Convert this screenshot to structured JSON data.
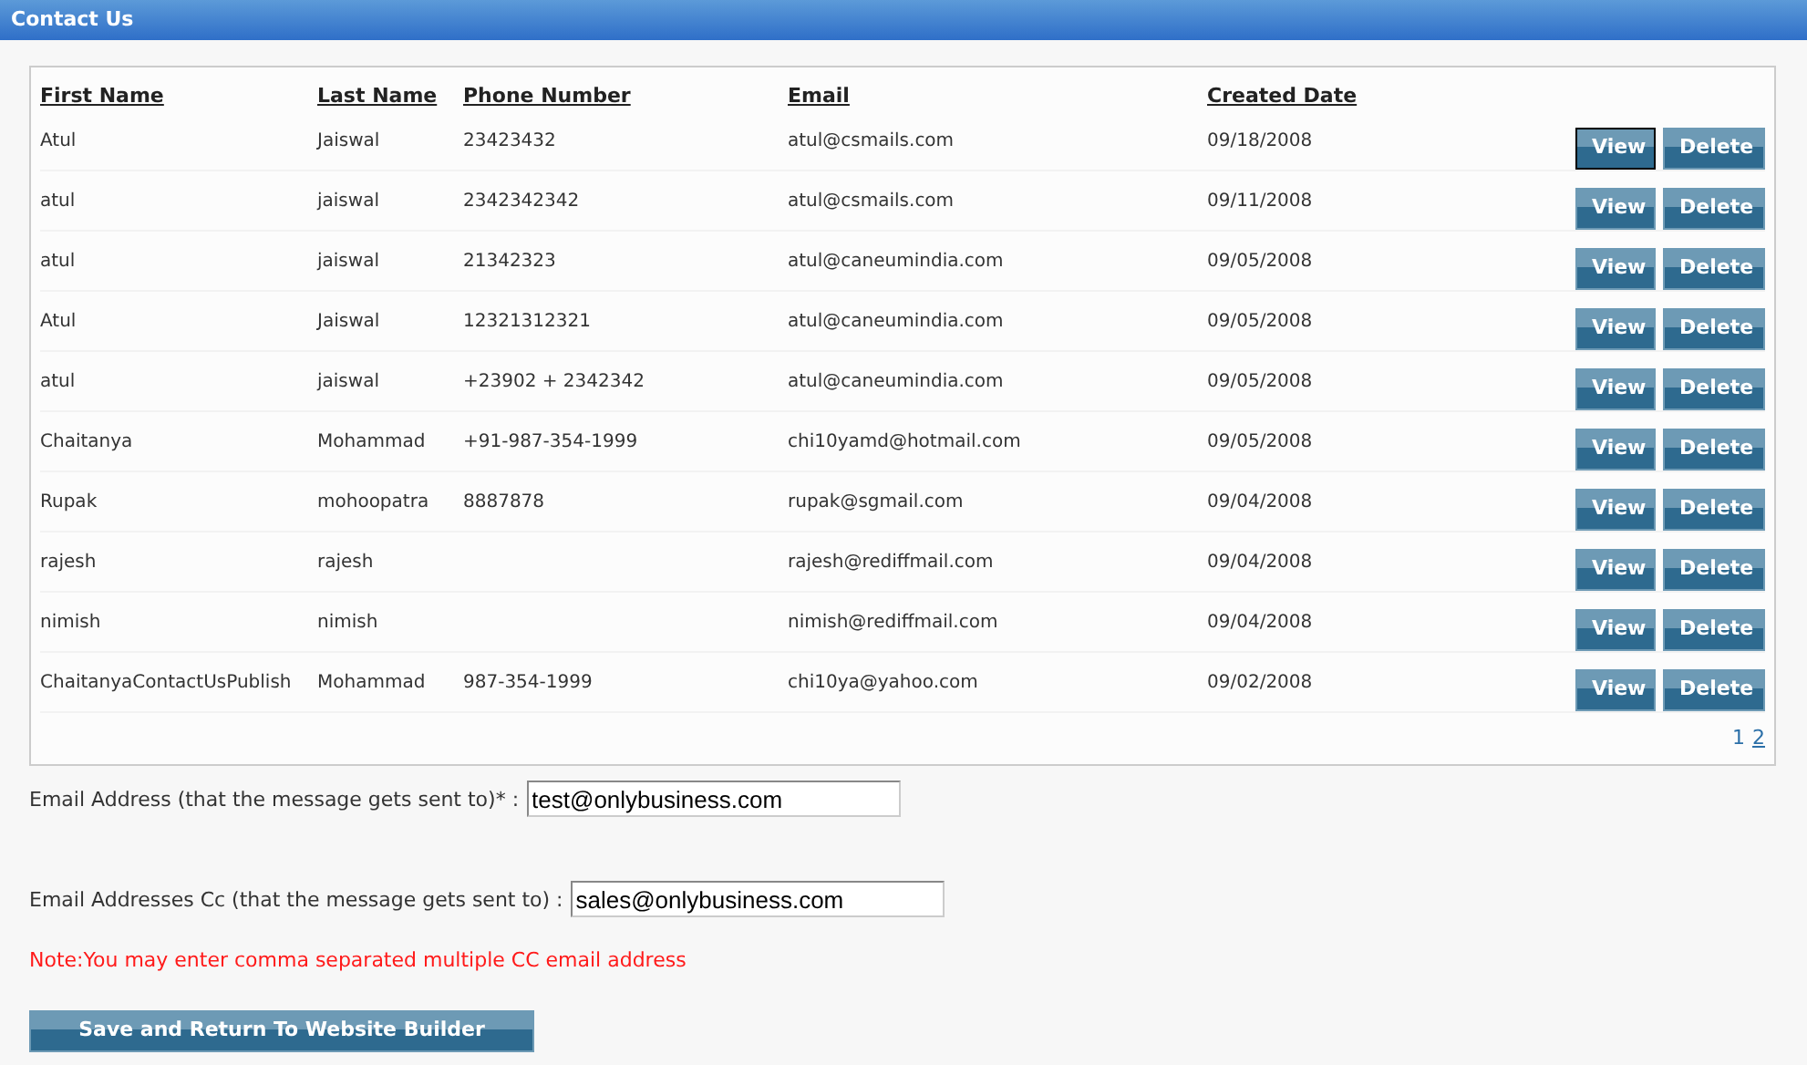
{
  "header": {
    "title": "Contact Us"
  },
  "table": {
    "columns": [
      "First Name",
      "Last Name",
      "Phone Number",
      "Email",
      "Created Date"
    ],
    "rows": [
      {
        "cells": [
          "Atul",
          "Jaiswal",
          "23423432",
          "atul@csmails.com",
          "09/18/2008"
        ],
        "actions": [
          {
            "label": "View",
            "focused": true
          },
          {
            "label": "Delete",
            "focused": false
          }
        ]
      },
      {
        "cells": [
          "atul",
          "jaiswal",
          "2342342342",
          "atul@csmails.com",
          "09/11/2008"
        ],
        "actions": [
          {
            "label": "View",
            "focused": false
          },
          {
            "label": "Delete",
            "focused": false
          }
        ]
      },
      {
        "cells": [
          "atul",
          "jaiswal",
          "21342323",
          "atul@caneumindia.com",
          "09/05/2008"
        ],
        "actions": [
          {
            "label": "View",
            "focused": false
          },
          {
            "label": "Delete",
            "focused": false
          }
        ]
      },
      {
        "cells": [
          "Atul",
          "Jaiswal",
          "12321312321",
          "atul@caneumindia.com",
          "09/05/2008"
        ],
        "actions": [
          {
            "label": "View",
            "focused": false
          },
          {
            "label": "Delete",
            "focused": false
          }
        ]
      },
      {
        "cells": [
          "atul",
          "jaiswal",
          "+23902 + 2342342",
          "atul@caneumindia.com",
          "09/05/2008"
        ],
        "actions": [
          {
            "label": "View",
            "focused": false
          },
          {
            "label": "Delete",
            "focused": false
          }
        ]
      },
      {
        "cells": [
          "Chaitanya",
          "Mohammad",
          "+91-987-354-1999",
          "chi10yamd@hotmail.com",
          "09/05/2008"
        ],
        "actions": [
          {
            "label": "View",
            "focused": false
          },
          {
            "label": "Delete",
            "focused": false
          }
        ]
      },
      {
        "cells": [
          "Rupak",
          "mohoopatra",
          "8887878",
          "rupak@sgmail.com",
          "09/04/2008"
        ],
        "actions": [
          {
            "label": "View",
            "focused": false
          },
          {
            "label": "Delete",
            "focused": false
          }
        ]
      },
      {
        "cells": [
          "rajesh",
          "rajesh",
          "",
          "rajesh@rediffmail.com",
          "09/04/2008"
        ],
        "actions": [
          {
            "label": "View",
            "focused": false
          },
          {
            "label": "Delete",
            "focused": false
          }
        ]
      },
      {
        "cells": [
          "nimish",
          "nimish",
          "",
          "nimish@rediffmail.com",
          "09/04/2008"
        ],
        "actions": [
          {
            "label": "View",
            "focused": false
          },
          {
            "label": "Delete",
            "focused": false
          }
        ]
      },
      {
        "cells": [
          "ChaitanyaContactUsPublish",
          "Mohammad",
          "987-354-1999",
          "chi10ya@yahoo.com",
          "09/02/2008"
        ],
        "actions": [
          {
            "label": "View",
            "focused": false
          },
          {
            "label": "Delete",
            "focused": false
          }
        ]
      }
    ],
    "pages": [
      {
        "label": "1",
        "selected": true
      },
      {
        "label": "2",
        "selected": false
      }
    ]
  },
  "form": {
    "email": {
      "label": "Email Address (that the message gets sent to)* :",
      "value": "test@onlybusiness.com"
    },
    "cc": {
      "label": "Email Addresses Cc (that the message gets sent to) :",
      "value": "sales@onlybusiness.com"
    },
    "note": "Note:You may enter comma separated multiple CC email address",
    "save_button": "Save and Return To Website Builder"
  }
}
